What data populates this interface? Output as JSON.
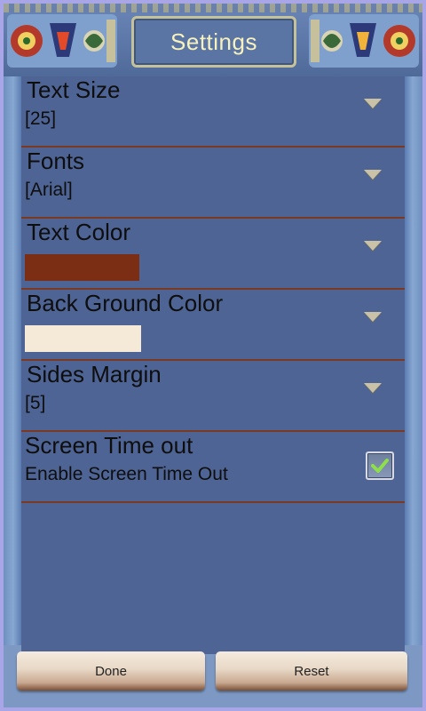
{
  "header": {
    "title": "Settings"
  },
  "settings": [
    {
      "title": "Text Size",
      "value": "[25]",
      "control": "dropdown"
    },
    {
      "title": "Fonts",
      "value": "[Arial]",
      "control": "dropdown"
    },
    {
      "title": "Text Color",
      "swatch_color": "#7b2e14",
      "control": "dropdown"
    },
    {
      "title": "Back Ground Color",
      "swatch_color": "#f5ead8",
      "control": "dropdown"
    },
    {
      "title": "Sides Margin",
      "value": "[5]",
      "control": "dropdown"
    },
    {
      "title": "Screen Time out",
      "value": "Enable Screen Time Out",
      "control": "checkbox",
      "checked": true
    }
  ],
  "buttons": {
    "done_label": "Done",
    "reset_label": "Reset"
  },
  "icons": {
    "dropdown": "chevron-down-icon",
    "checkbox": "checkmark-icon"
  },
  "colors": {
    "panel": "#4e6494",
    "divider": "#7a3a22",
    "title_text": "#f7f1bd",
    "checkmark": "#8ee04a"
  }
}
